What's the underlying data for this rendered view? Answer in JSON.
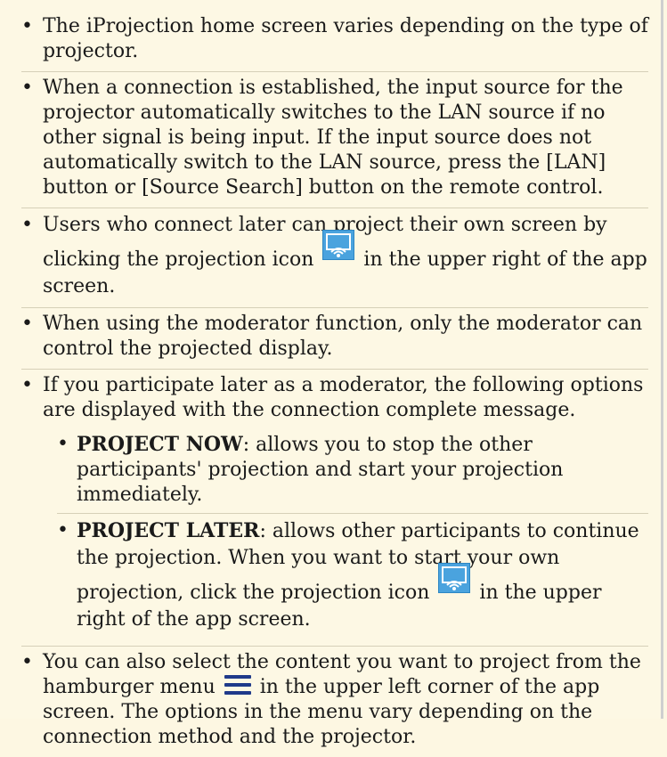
{
  "notes": [
    {
      "text": "The iProjection home screen varies depending on the type of projector."
    },
    {
      "text": "When a connection is established, the input source for the projector automatically switches to the LAN source if no other signal is being input. If the input source does not automatically switch to the LAN source, press the [LAN] button or [Source Search] button on the remote control."
    },
    {
      "before": "Users who connect later can project their own screen by clicking the projection icon",
      "after": "in the upper right of the app screen."
    },
    {
      "text": "When using the moderator function, only the moderator can control the projected display."
    },
    {
      "text": "If you participate later as a moderator, the following options are displayed with the connection complete message.",
      "sub": [
        {
          "term": "PROJECT NOW",
          "rest": ": allows you to stop the other participants' projection and start your projection immediately."
        },
        {
          "term": "PROJECT LATER",
          "rest": ": allows other participants to continue the projection. When you want to start your own projection, click the projection icon",
          "after": "in the upper right of the app screen."
        }
      ]
    },
    {
      "before": "You can also select the content you want to project from the hamburger menu",
      "after": "in the upper left corner of the app screen. The options in the menu vary depending on the connection method and the projector."
    }
  ],
  "icons": {
    "projection": "projection-icon",
    "hamburger": "hamburger-menu-icon"
  },
  "colors": {
    "background": "#fdf8e4",
    "projection_icon": "#4aa3de",
    "hamburger_icon": "#1f3a8a"
  }
}
